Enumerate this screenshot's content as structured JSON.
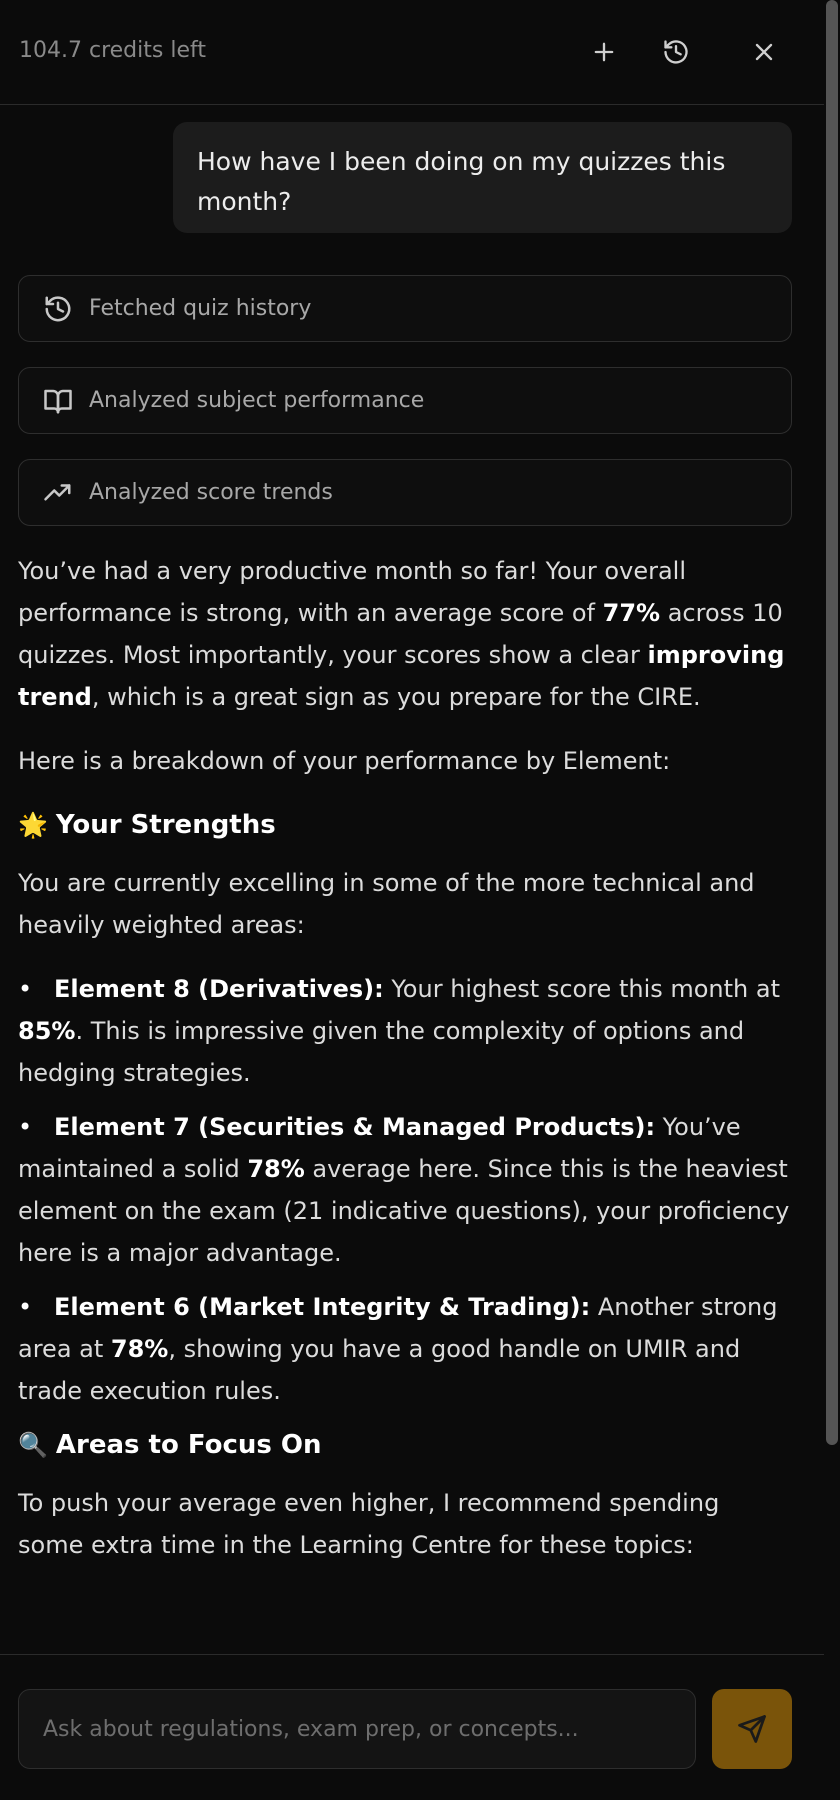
{
  "header": {
    "credits": "104.7 credits left",
    "new_chat_icon": "plus-icon",
    "history_icon": "history-icon",
    "close_icon": "close-icon"
  },
  "user_message": "How have I been doing on my quizzes this month?",
  "tools": [
    {
      "label": "Fetched quiz history",
      "icon": "history-icon"
    },
    {
      "label": "Analyzed subject performance",
      "icon": "book-open-icon"
    },
    {
      "label": "Analyzed score trends",
      "icon": "trending-up-icon"
    }
  ],
  "answer": {
    "p1_a": "You’ve had a very productive month so far! Your overall performance is strong, with an average score of ",
    "p1_b": "77%",
    "p1_c": " across 10 quizzes. Most importantly, your scores show a clear ",
    "p1_d": "improving trend",
    "p1_e": ", which is a great sign as you prepare for the CIRE.",
    "p2": "Here is a breakdown of your performance by Element:",
    "strengths_emoji": "🌟",
    "strengths_title": "Your Strengths",
    "p3": "You are currently excelling in some of the more technical and heavily weighted areas:",
    "bullets": [
      {
        "title": "Element 8 (Derivatives):",
        "a": " Your highest score this month at ",
        "b": "85%",
        "c": ". This is impressive given the complexity of options and hedging strategies."
      },
      {
        "title": "Element 7 (Securities & Managed Products):",
        "a": " You’ve maintained a solid ",
        "b": "78%",
        "c": " average here. Since this is the heaviest element on the exam (21 indicative questions), your proficiency here is a major advantage."
      },
      {
        "title": "Element 6 (Market Integrity & Trading):",
        "a": " Another strong area at ",
        "b": "78%",
        "c": ", showing you have a good handle on UMIR and trade execution rules."
      }
    ],
    "focus_emoji": "🔍",
    "focus_title": "Areas to Focus On",
    "p4": "To push your average even higher, I recommend spending some extra time in the Learning Centre for these topics:"
  },
  "footer": {
    "placeholder": "Ask about regulations, exam prep, or concepts...",
    "send_icon": "send-icon",
    "send_color": "#7a540a"
  }
}
